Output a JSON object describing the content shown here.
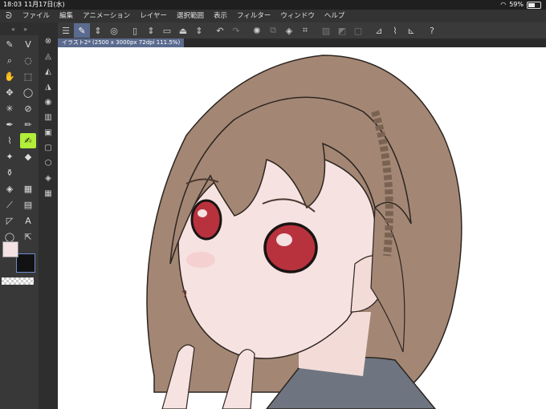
{
  "status": {
    "time": "18:03",
    "date": "11月17日(水)",
    "battery": "59%",
    "battery_level": 0.59
  },
  "menu": {
    "items": [
      "ファイル",
      "編集",
      "アニメーション",
      "レイヤー",
      "選択範囲",
      "表示",
      "フィルター",
      "ウィンドウ",
      "ヘルプ"
    ]
  },
  "tab": {
    "title": "イラスト2* (2500 x 3000px 72dpi 111.5%)"
  },
  "colors": {
    "foreground": "#f4e1e4",
    "background": "#121212",
    "accent": "#5b6b8f",
    "active_tool": "#b2ee3a"
  },
  "icons": {
    "app_logo": "clip-studio-logo-icon",
    "wifi": "wifi-icon"
  }
}
